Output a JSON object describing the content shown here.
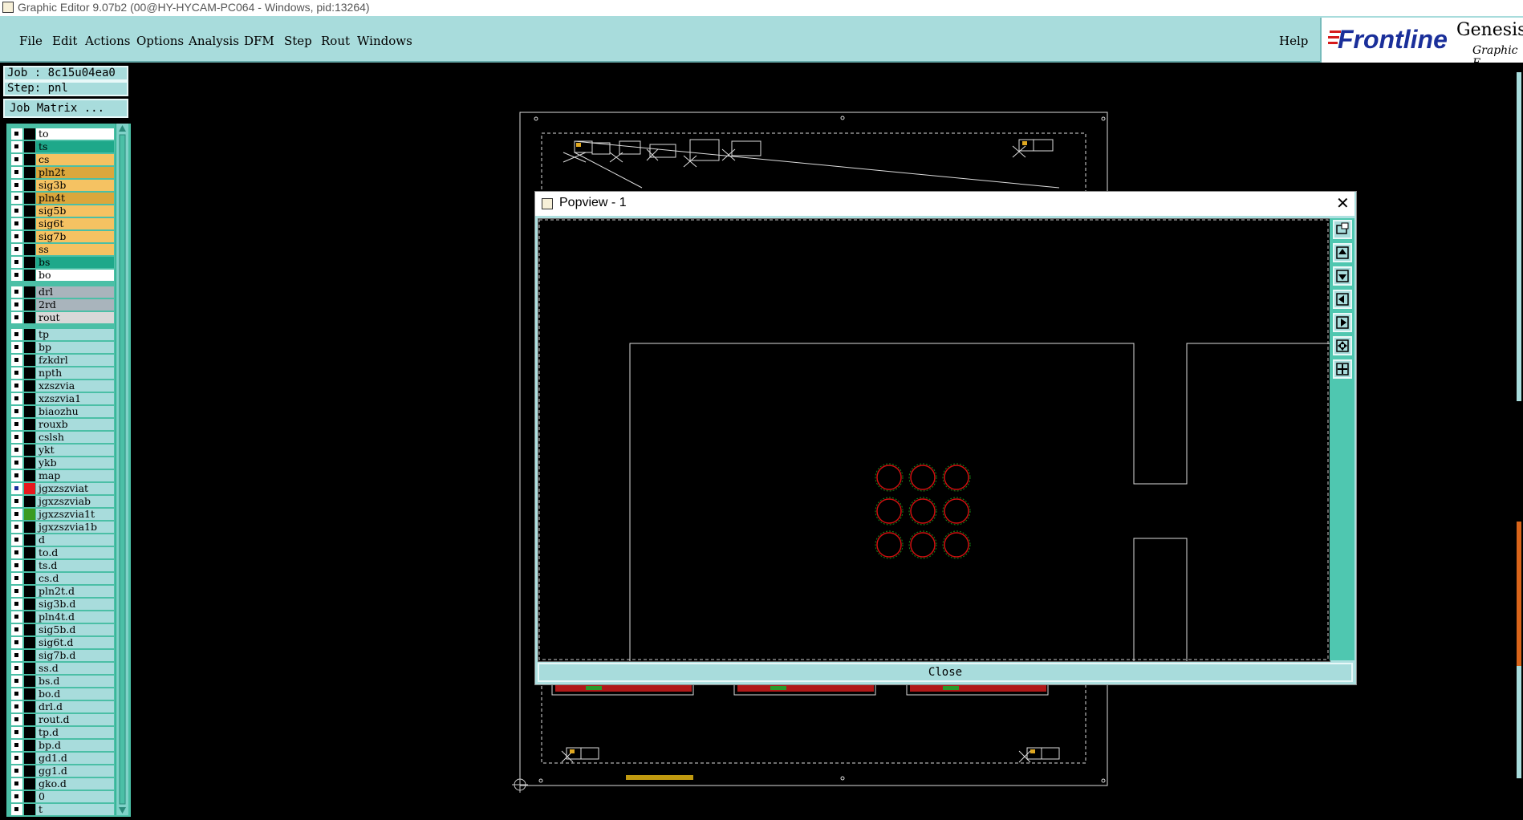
{
  "window": {
    "title": "Graphic Editor 9.07b2 (00@HY-HYCAM-PC064 - Windows, pid:13264)"
  },
  "menu": {
    "items": [
      "File",
      "Edit",
      "Actions",
      "Options",
      "Analysis",
      "DFM",
      "Step",
      "Rout",
      "Windows"
    ],
    "help": "Help"
  },
  "logo": {
    "brand": "Frontline",
    "product": "Genesis",
    "subtitle": "Graphic E"
  },
  "info": {
    "job": "Job : 8c15u04ea0",
    "step": "Step: pnl",
    "matrix": "Job Matrix ..."
  },
  "layers": [
    {
      "name": "to",
      "color": "#ffffff"
    },
    {
      "name": "ts",
      "color": "#1ea88a"
    },
    {
      "name": "cs",
      "color": "#f5c262"
    },
    {
      "name": "pln2t",
      "color": "#dba73c"
    },
    {
      "name": "sig3b",
      "color": "#f5c262"
    },
    {
      "name": "pln4t",
      "color": "#dba73c"
    },
    {
      "name": "sig5b",
      "color": "#f5c262"
    },
    {
      "name": "sig6t",
      "color": "#f5c262"
    },
    {
      "name": "sig7b",
      "color": "#f5c262"
    },
    {
      "name": "ss",
      "color": "#f5c262"
    },
    {
      "name": "bs",
      "color": "#1ea88a"
    },
    {
      "name": "bo",
      "color": "#ffffff"
    },
    {
      "name": "drl",
      "color": "#a9b4bc"
    },
    {
      "name": "2rd",
      "color": "#a9b4bc"
    },
    {
      "name": "rout",
      "color": "#d8d8d8"
    },
    {
      "name": "tp",
      "color": "#a8dcdc"
    },
    {
      "name": "bp",
      "color": "#a8dcdc"
    },
    {
      "name": "fzkdrl",
      "color": "#a8dcdc"
    },
    {
      "name": "npth",
      "color": "#a8dcdc"
    },
    {
      "name": "xzszvia",
      "color": "#a8dcdc"
    },
    {
      "name": "xzszvia1",
      "color": "#a8dcdc"
    },
    {
      "name": "biaozhu",
      "color": "#a8dcdc"
    },
    {
      "name": "rouxb",
      "color": "#a8dcdc"
    },
    {
      "name": "cslsh",
      "color": "#a8dcdc"
    },
    {
      "name": "ykt",
      "color": "#a8dcdc"
    },
    {
      "name": "ykb",
      "color": "#a8dcdc"
    },
    {
      "name": "map",
      "color": "#a8dcdc"
    },
    {
      "name": "jgxzszviat",
      "color": "#a8dcdc",
      "swatch": "#e8181e",
      "active": true
    },
    {
      "name": "jgxzszviab",
      "color": "#a8dcdc"
    },
    {
      "name": "jgxzszvia1t",
      "color": "#a8dcdc",
      "swatch": "#3a9a20"
    },
    {
      "name": "jgxzszvia1b",
      "color": "#a8dcdc"
    },
    {
      "name": "d",
      "color": "#a8dcdc"
    },
    {
      "name": "to.d",
      "color": "#a8dcdc"
    },
    {
      "name": "ts.d",
      "color": "#a8dcdc"
    },
    {
      "name": "cs.d",
      "color": "#a8dcdc"
    },
    {
      "name": "pln2t.d",
      "color": "#a8dcdc"
    },
    {
      "name": "sig3b.d",
      "color": "#a8dcdc"
    },
    {
      "name": "pln4t.d",
      "color": "#a8dcdc"
    },
    {
      "name": "sig5b.d",
      "color": "#a8dcdc"
    },
    {
      "name": "sig6t.d",
      "color": "#a8dcdc"
    },
    {
      "name": "sig7b.d",
      "color": "#a8dcdc"
    },
    {
      "name": "ss.d",
      "color": "#a8dcdc"
    },
    {
      "name": "bs.d",
      "color": "#a8dcdc"
    },
    {
      "name": "bo.d",
      "color": "#a8dcdc"
    },
    {
      "name": "drl.d",
      "color": "#a8dcdc"
    },
    {
      "name": "rout.d",
      "color": "#a8dcdc"
    },
    {
      "name": "tp.d",
      "color": "#a8dcdc"
    },
    {
      "name": "bp.d",
      "color": "#a8dcdc"
    },
    {
      "name": "gd1.d",
      "color": "#a8dcdc"
    },
    {
      "name": "gg1.d",
      "color": "#a8dcdc"
    },
    {
      "name": "gko.d",
      "color": "#a8dcdc"
    },
    {
      "name": "0",
      "color": "#a8dcdc"
    },
    {
      "name": "t",
      "color": "#a8dcdc"
    }
  ],
  "popview": {
    "title": "Popview - 1",
    "close_label": "Close",
    "tools": [
      "zoom-window-icon",
      "pan-up-icon",
      "pan-down-icon",
      "pan-left-icon",
      "pan-right-icon",
      "zoom-fit-icon",
      "zoom-home-icon"
    ]
  }
}
